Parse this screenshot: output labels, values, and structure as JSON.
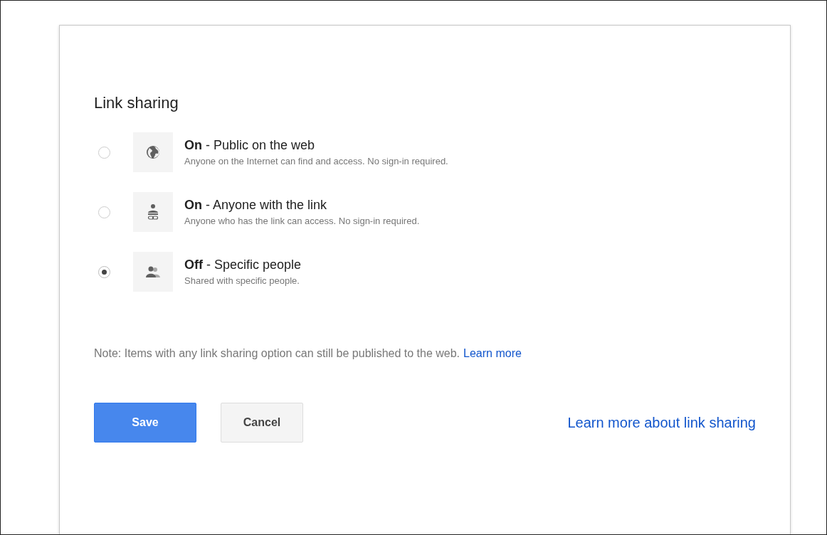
{
  "dialog": {
    "title": "Link sharing",
    "options": [
      {
        "kind": "globe",
        "label": "**On** - Public on the web",
        "description": "Anyone on the Internet can find and access. No sign-in required.",
        "selected": false
      },
      {
        "kind": "link",
        "label": "**On** - Anyone with the link",
        "description": "Anyone who has the link can access. No sign-in required.",
        "selected": false
      },
      {
        "kind": "people",
        "label": "**Off** - Specific people",
        "description": "Shared with specific people.",
        "selected": true
      }
    ],
    "note": "Note: Items with any link sharing option can still be published to the web.",
    "note_link": "Learn more",
    "buttons": [
      {
        "kind": "primary",
        "label": "Save"
      },
      {
        "kind": "secondary",
        "label": "Cancel"
      }
    ],
    "help_link": "Learn more about link sharing"
  }
}
